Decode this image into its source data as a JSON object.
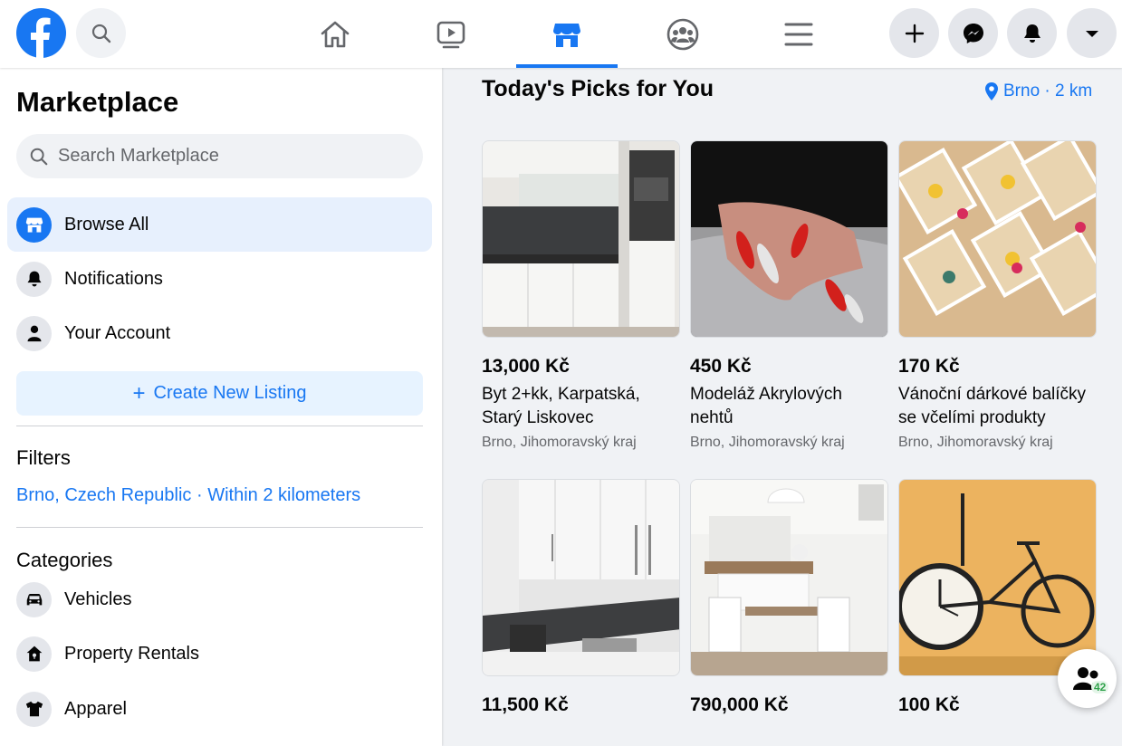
{
  "header": {
    "nav_tabs": [
      {
        "name": "home"
      },
      {
        "name": "watch"
      },
      {
        "name": "marketplace",
        "active": true
      },
      {
        "name": "groups"
      },
      {
        "name": "menu"
      }
    ],
    "actions": [
      "create",
      "messenger",
      "notifications",
      "account"
    ]
  },
  "sidebar": {
    "title": "Marketplace",
    "search_placeholder": "Search Marketplace",
    "items": [
      {
        "label": "Browse All",
        "active": true
      },
      {
        "label": "Notifications"
      },
      {
        "label": "Your Account"
      }
    ],
    "create_label": "Create New Listing",
    "filters_heading": "Filters",
    "filter_location": "Brno, Czech Republic · Within 2 kilometers",
    "categories_heading": "Categories",
    "categories": [
      {
        "label": "Vehicles"
      },
      {
        "label": "Property Rentals"
      },
      {
        "label": "Apparel"
      }
    ]
  },
  "main": {
    "title": "Today's Picks for You",
    "location_label": "Brno · 2 km",
    "listings": [
      {
        "price": "13,000 Kč",
        "title": "Byt 2+kk, Karpatská, Starý Liskovec",
        "location": "Brno, Jihomoravský kraj",
        "image": "kitchen"
      },
      {
        "price": "450 Kč",
        "title": "Modeláž Akrylových nehtů",
        "location": "Brno, Jihomoravský kraj",
        "image": "nails"
      },
      {
        "price": "170 Kč",
        "title": "Vánoční dárkové balíčky se včelími produkty",
        "location": "Brno, Jihomoravský kraj",
        "image": "gift-boxes"
      },
      {
        "price": "11,500 Kč",
        "title": "",
        "location": "",
        "image": "kitchen-white"
      },
      {
        "price": "790,000 Kč",
        "title": "",
        "location": "",
        "image": "dining-room"
      },
      {
        "price": "100 Kč",
        "title": "",
        "location": "",
        "image": "bicycle-clock"
      }
    ]
  },
  "chat": {
    "online_count": "42"
  },
  "colors": {
    "accent": "#1877f2",
    "background": "#f0f2f5"
  }
}
